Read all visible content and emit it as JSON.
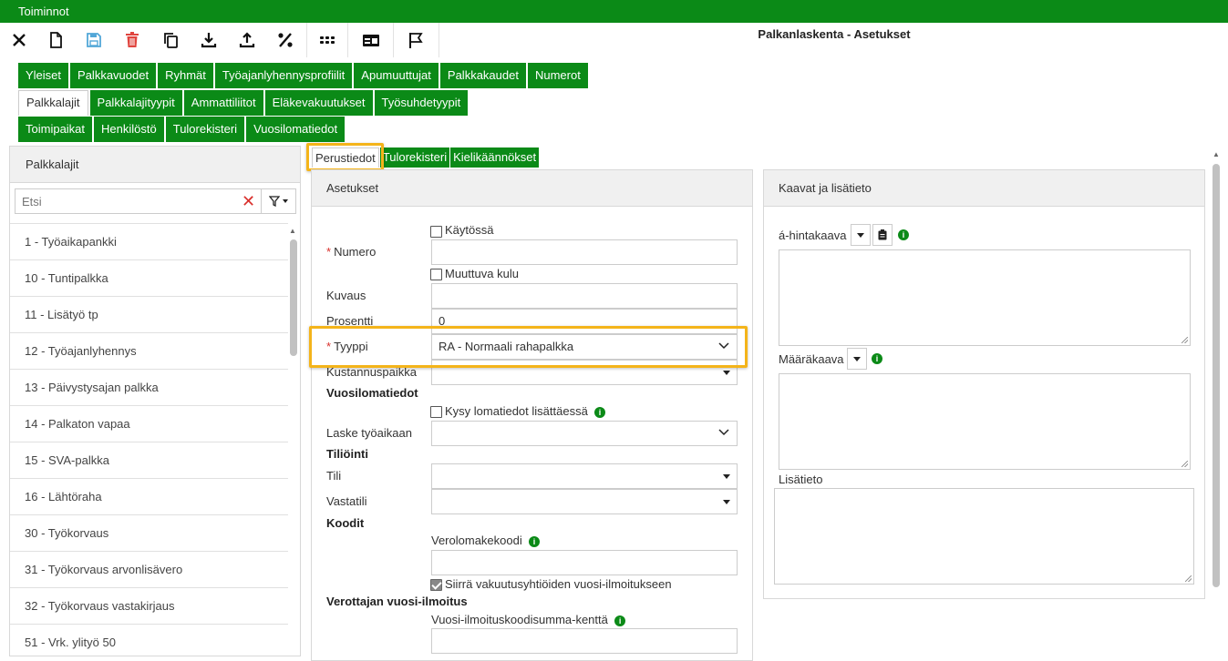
{
  "menu": {
    "title": "Toiminnot"
  },
  "app_title": "Palkanlaskenta - Asetukset",
  "toolbar": {
    "buttons": [
      "close-icon",
      "new-document-icon",
      "save-icon",
      "delete-icon",
      "copy-icon",
      "download-icon",
      "upload-icon",
      "percent-icon",
      "apps-grid-icon",
      "id-card-icon",
      "flag-icon"
    ]
  },
  "tabs": {
    "row1": [
      "Yleiset",
      "Palkkavuodet",
      "Ryhmät",
      "Työajanlyhennysprofiilit",
      "Apumuuttujat",
      "Palkkakaudet",
      "Numerot"
    ],
    "row2": [
      "Palkkalajit",
      "Palkkalajityypit",
      "Ammattiliitot",
      "Eläkevakuutukset",
      "Työsuhdetyypit"
    ],
    "row3": [
      "Toimipaikat",
      "Henkilöstö",
      "Tulorekisteri",
      "Vuosilomatiedot"
    ],
    "active": "Palkkalajit"
  },
  "left_panel": {
    "title": "Palkkalajit",
    "search_placeholder": "Etsi",
    "items": [
      "1 - Työaikapankki",
      "10 - Tuntipalkka",
      "11 - Lisätyö tp",
      "12 - Työajanlyhennys",
      "13 - Päivystysajan palkka",
      "14 - Palkaton vapaa",
      "15 - SVA-palkka",
      "16 - Lähtöraha",
      "30 - Työkorvaus",
      "31 - Työkorvaus arvonlisävero",
      "32 - Työkorvaus vastakirjaus",
      "51 - Vrk. ylityö 50"
    ]
  },
  "subtabs": [
    "Perustiedot",
    "Tulorekisteri",
    "Kielikäännökset"
  ],
  "settings": {
    "title": "Asetukset",
    "kaytossa": "Käytössä",
    "numero_label": "Numero",
    "numero_value": "",
    "muuttuva_kulu": "Muuttuva kulu",
    "kuvaus_label": "Kuvaus",
    "kuvaus_value": "",
    "prosentti_label": "Prosentti",
    "prosentti_value": "0",
    "tyyppi_label": "Tyyppi",
    "tyyppi_value": "RA - Normaali rahapalkka",
    "kustannuspaikka_label": "Kustannuspaikka",
    "vuosiloma_section": "Vuosilomatiedot",
    "kysy_lomatiedot": "Kysy lomatiedot lisättäessä",
    "laske_tyoaikaan_label": "Laske työaikaan",
    "tiliointi_section": "Tiliöinti",
    "tili_label": "Tili",
    "vastatili_label": "Vastatili",
    "koodit_section": "Koodit",
    "verolomakekoodi_label": "Verolomakekoodi",
    "siirra_label": "Siirrä vakuutusyhtiöiden vuosi-ilmoitukseen",
    "verottaja_section": "Verottajan vuosi-ilmoitus",
    "vuosi_ilmoitus_label": "Vuosi-ilmoituskoodisumma-kenttä"
  },
  "formulas": {
    "title": "Kaavat ja lisätieto",
    "a_hintakaava": "á-hintakaava",
    "maarakaava": "Määräkaava",
    "lisatieto": "Lisätieto"
  },
  "colors": {
    "brand_green": "#0b8a17",
    "highlight": "#f4b41a",
    "required": "#d9302c"
  }
}
